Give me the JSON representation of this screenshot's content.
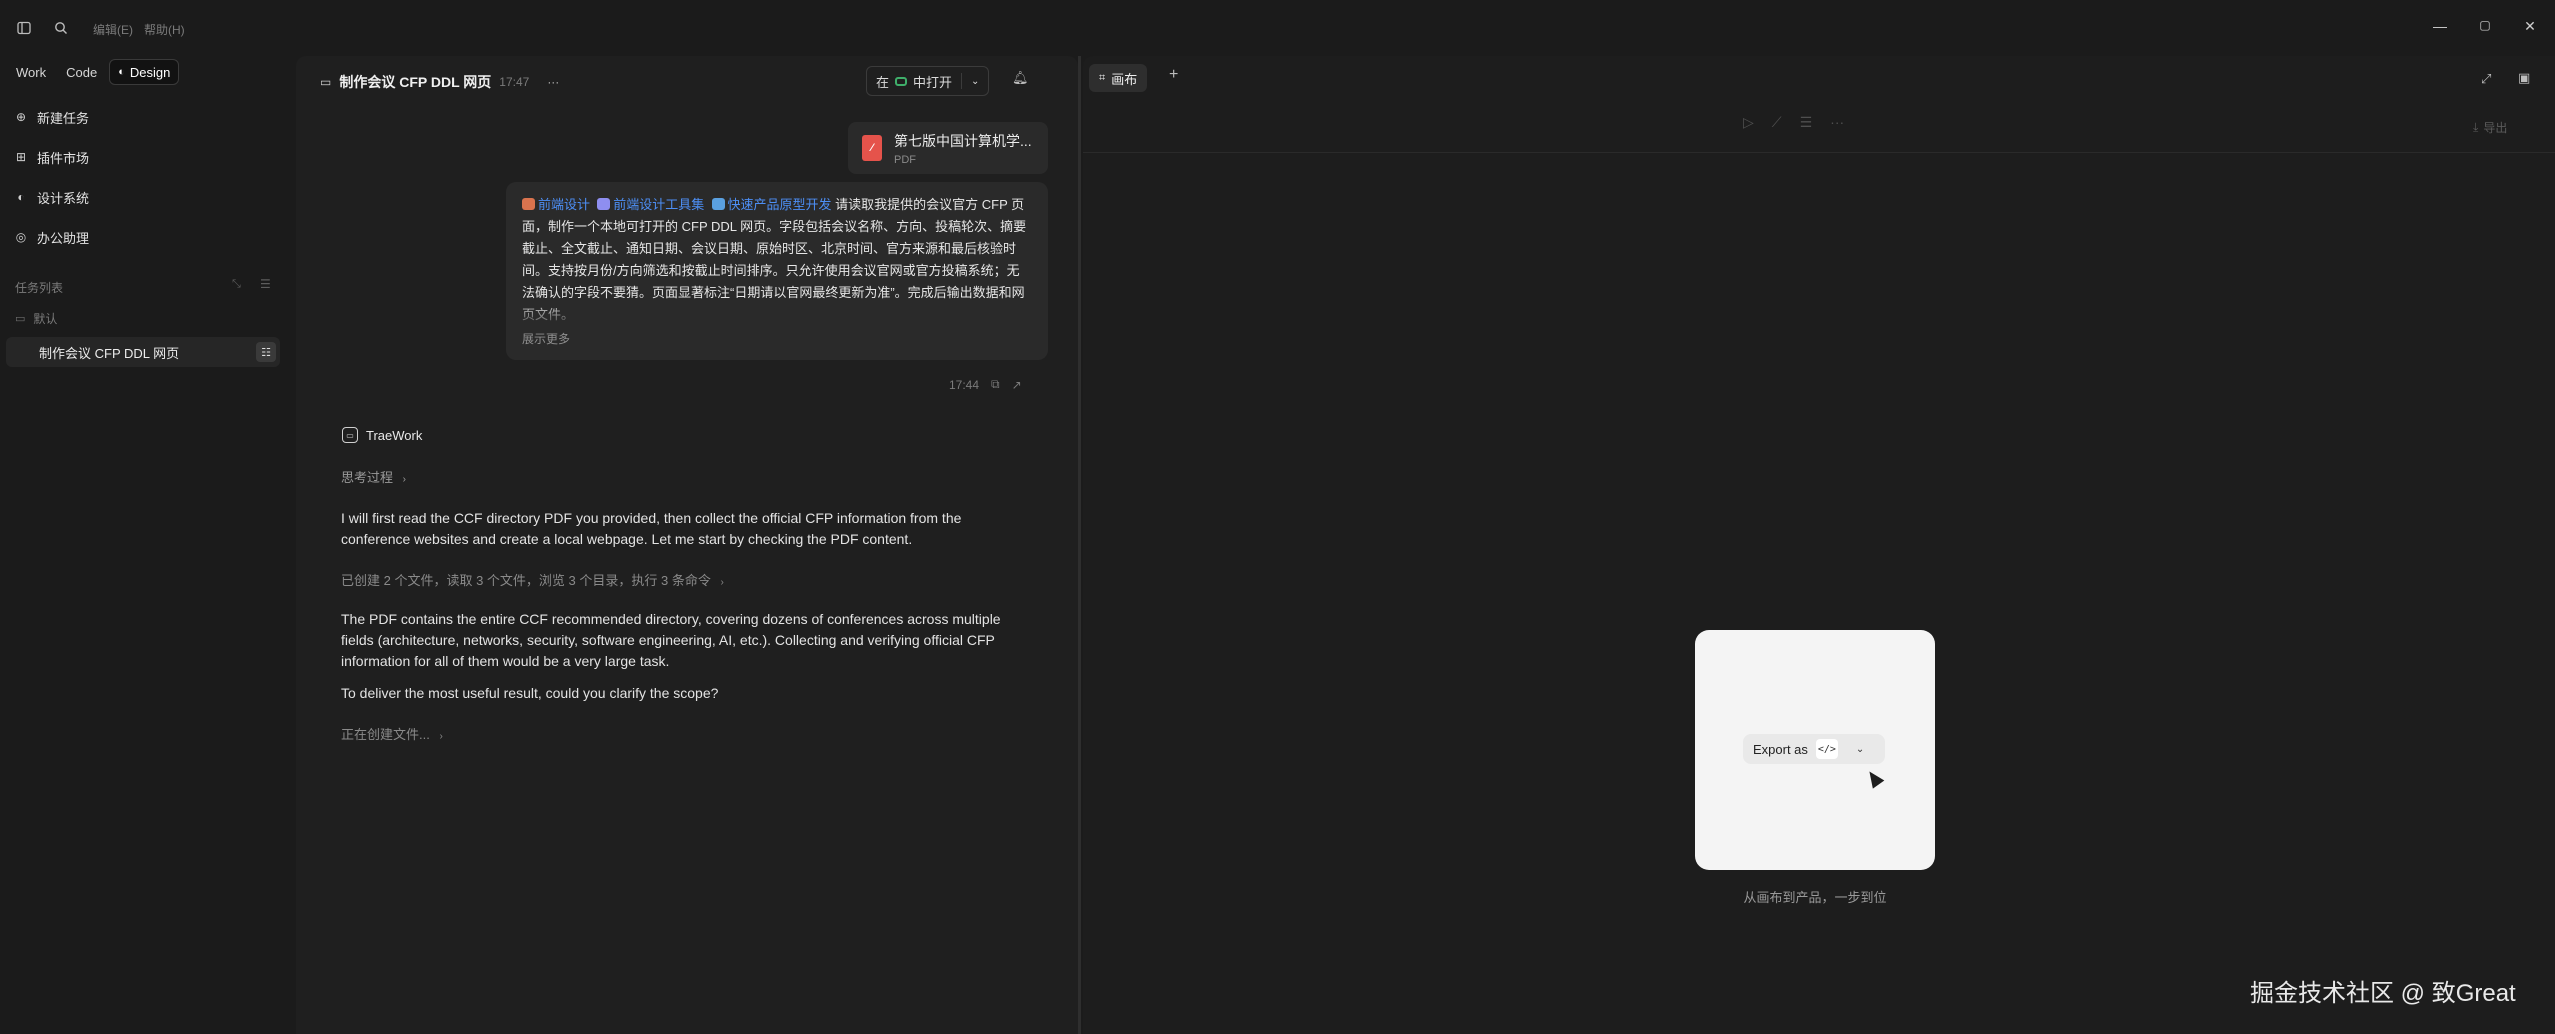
{
  "titlebar": {
    "menu_edit": "编辑(E)",
    "menu_help": "帮助(H)",
    "minimize": "—",
    "restore": "▢",
    "close": "✕"
  },
  "sidebar": {
    "modes": [
      "Work",
      "Code",
      "Design"
    ],
    "items": [
      {
        "label": "新建任务",
        "icon": "new-task-icon"
      },
      {
        "label": "插件市场",
        "icon": "plugin-grid-icon"
      },
      {
        "label": "设计系统",
        "icon": "palette-icon"
      },
      {
        "label": "办公助理",
        "icon": "assistant-icon"
      }
    ],
    "task_list_title": "任务列表",
    "group_default": "默认",
    "task_item": "制作会议 CFP DDL 网页"
  },
  "chat": {
    "title": "制作会议 CFP DDL 网页",
    "title_time": "17:47",
    "more": "···",
    "open_in_prefix": "在",
    "open_in_label": "中打开",
    "attachment": {
      "name": "第七版中国计算机学...",
      "type": "PDF"
    },
    "user_message": {
      "tags": [
        "前端设计",
        "前端设计工具集",
        "快速产品原型开发"
      ],
      "text": "请读取我提供的会议官方 CFP 页面，制作一个本地可打开的 CFP DDL 网页。字段包括会议名称、方向、投稿轮次、摘要截止、全文截止、通知日期、会议日期、原始时区、北京时间、官方来源和最后核验时间。支持按月份/方向筛选和按截止时间排序。只允许使用会议官网或官方投稿系统；无法确认的字段不要猜。页面显著标注“日期请以官网最终更新为准”。完成后输出数据和网页文件。",
      "show_more": "展示更多",
      "time": "17:44"
    },
    "bot_name": "TraeWork",
    "thinking": "思考过程",
    "para1": "I will first read the CCF directory PDF you provided, then collect the official CFP information from the conference websites and create a local webpage. Let me start by checking the PDF content.",
    "summary_line": "已创建 2 个文件，读取 3 个文件，浏览 3 个目录，执行 3 条命令",
    "para2": "The PDF contains the entire CCF recommended directory, covering dozens of conferences across multiple fields (architecture, networks, security, software engineering, AI, etc.). Collecting and verifying official CFP information for all of them would be a very large task.",
    "para3": "To deliver the most useful result, could you clarify the scope?",
    "creating": "正在创建文件..."
  },
  "canvas": {
    "tab_label": "画布",
    "add_tab": "+",
    "export_top": "导出",
    "export_as": "Export as",
    "code_chip": "</>",
    "caption": "从画布到产品，一步到位"
  },
  "watermark": "掘金技术社区 @ 致Great",
  "colors": {
    "accent_blue": "#4d8ff5",
    "pdf_red": "#e5534b",
    "green": "#3fae6a",
    "bg": "#1b1b1b"
  }
}
